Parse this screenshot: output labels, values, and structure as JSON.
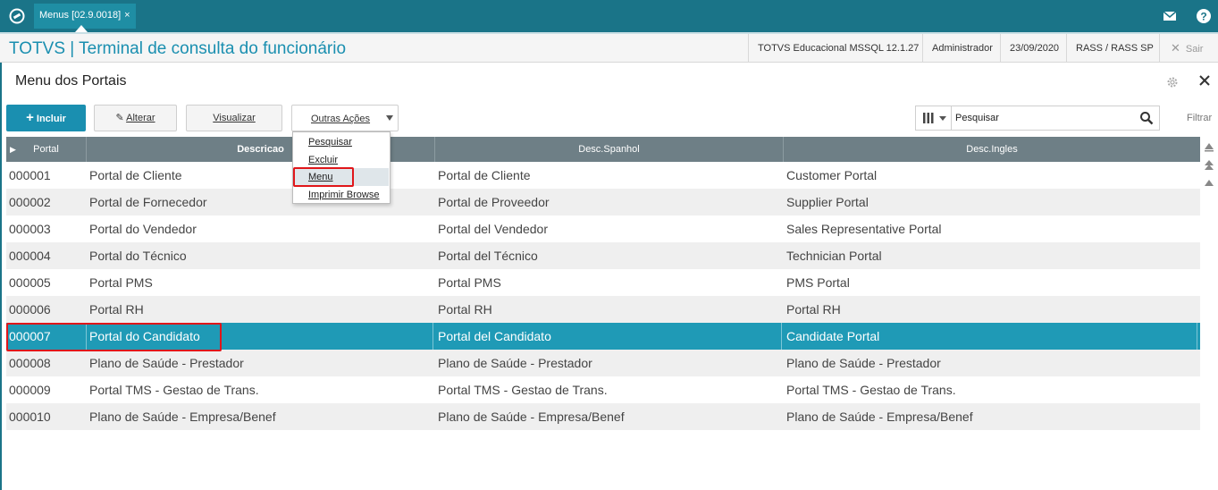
{
  "tab": {
    "label": "Menus [02.9.0018]",
    "close": "×"
  },
  "header": {
    "app_title": "TOTVS | Terminal de consulta do funcionário",
    "environment": "TOTVS Educacional MSSQL 12.1.27",
    "user": "Administrador",
    "date": "23/09/2020",
    "branch": "RASS / RASS SP",
    "exit_label": "Sair"
  },
  "page": {
    "title": "Menu dos Portais"
  },
  "toolbar": {
    "incluir": "Incluir",
    "alterar": "Alterar",
    "visualizar": "Visualizar",
    "outras_acoes": "Outras Ações"
  },
  "search": {
    "placeholder": "Pesquisar",
    "filter_label": "Filtrar"
  },
  "dropdown": {
    "items": [
      "Pesquisar",
      "Excluir",
      "Menu",
      "Imprimir Browse"
    ],
    "hovered": "Menu"
  },
  "grid": {
    "columns": [
      "Portal",
      "Descricao",
      "Desc.Spanhol",
      "Desc.Ingles"
    ],
    "rows": [
      [
        "000001",
        "Portal de Cliente",
        "Portal de Cliente",
        "Customer Portal"
      ],
      [
        "000002",
        "Portal de Fornecedor",
        "Portal de Proveedor",
        "Supplier Portal"
      ],
      [
        "000003",
        "Portal do Vendedor",
        "Portal del Vendedor",
        "Sales Representative Portal"
      ],
      [
        "000004",
        "Portal do Técnico",
        "Portal del Técnico",
        "Technician Portal"
      ],
      [
        "000005",
        "Portal PMS",
        "Portal PMS",
        "PMS Portal"
      ],
      [
        "000006",
        "Portal RH",
        "Portal RH",
        "Portal RH"
      ],
      [
        "000007",
        "Portal do Candidato",
        "Portal del Candidato",
        "Candidate Portal"
      ],
      [
        "000008",
        "Plano de Saúde - Prestador",
        "Plano de Saúde - Prestador",
        "Plano de Saúde - Prestador"
      ],
      [
        "000009",
        "Portal TMS - Gestao de Trans.",
        "Portal TMS - Gestao de Trans.",
        "Portal TMS - Gestao de Trans."
      ],
      [
        "000010",
        "Plano de Saúde - Empresa/Benef",
        "Plano de Saúde - Empresa/Benef",
        "Plano de Saúde - Empresa/Benef"
      ]
    ],
    "selected_row": 6
  },
  "icons": {
    "logo": "totvs-logo-icon",
    "mail": "mail-icon",
    "help": "help-icon",
    "settings": "gear-icon",
    "close": "close-icon",
    "search": "search-icon",
    "columns": "columns-icon"
  },
  "colors": {
    "topbar": "#1a7488",
    "accent": "#1a8fb0",
    "selected_row": "#1f9ab6",
    "grid_header": "#6e7f86",
    "highlight": "#e0161a"
  }
}
